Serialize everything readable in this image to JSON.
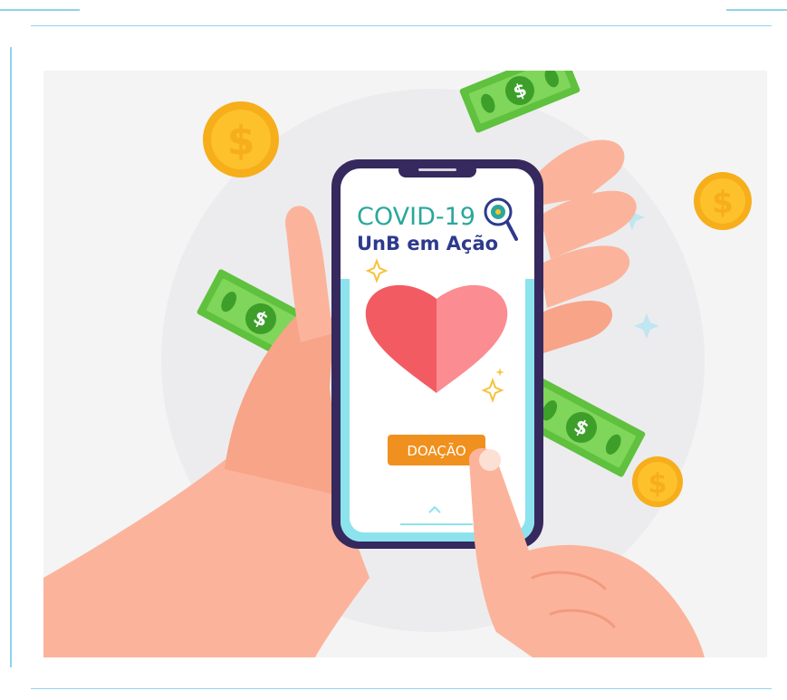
{
  "logo": {
    "line1": "COVID-19",
    "line2": "UnB em Ação"
  },
  "donate_button": {
    "label": "DOAÇÃO"
  },
  "colors": {
    "frame": "#8fd3ee",
    "background": "#f4f4f5",
    "phone_frame": "#35295e",
    "phone_accent": "#8ce3ee",
    "covid_text": "#2ba79d",
    "unb_text": "#2d3a8c",
    "button": "#f0901e",
    "heart_left": "#f35b62",
    "heart_right": "#fb8c92",
    "skin": "#fbb49b",
    "coin": "#fdc12b",
    "bill": "#5fc13d"
  },
  "icons": [
    "magnifier-virus-icon",
    "heart-icon",
    "sparkle-icon",
    "coin-icon",
    "banknote-icon",
    "swipe-up-chevron-icon"
  ]
}
